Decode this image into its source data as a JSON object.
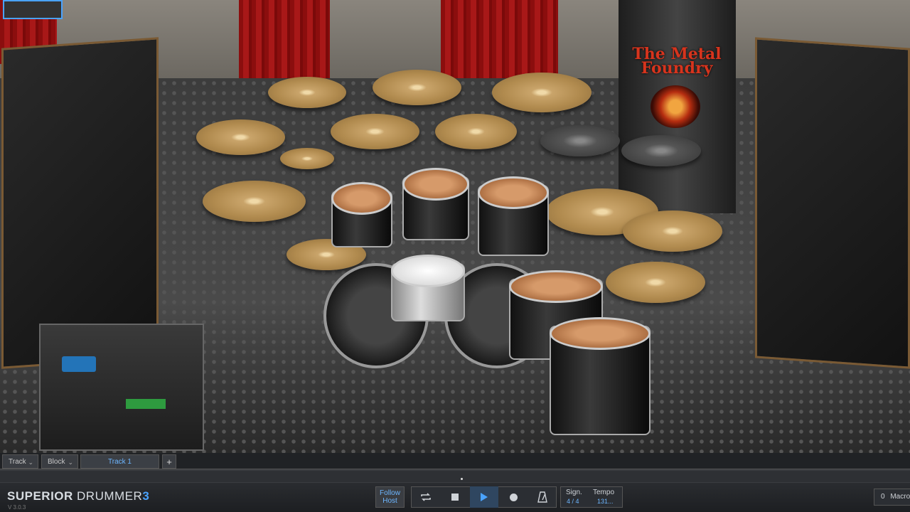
{
  "app": {
    "name_part1": "SUPERIOR",
    "name_part2": "DRUMMER",
    "name_part3": "3",
    "version": "V 3.0.3"
  },
  "stage": {
    "banner_text": "The Metal Foundry"
  },
  "tab_bar": {
    "track_menu": "Track",
    "block_menu": "Block",
    "active_tab": "Track 1",
    "add_tab": "+"
  },
  "transport": {
    "follow_host_line1": "Follow",
    "follow_host_line2": "Host",
    "sign_label": "Sign.",
    "sign_value": "4 / 4",
    "tempo_label": "Tempo",
    "tempo_value": "131..."
  },
  "macro": {
    "count": "0",
    "label": "Macro"
  },
  "colors": {
    "accent": "#4aa3ff",
    "panel_bg": "#2b2e33"
  }
}
